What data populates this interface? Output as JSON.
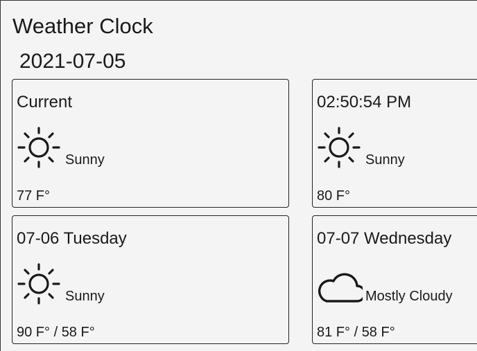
{
  "app": {
    "title": "Weather Clock",
    "date": "2021-07-05"
  },
  "cards": [
    {
      "title": "Current",
      "icon": "sun-icon",
      "condition": "Sunny",
      "temperature": "77 F°"
    },
    {
      "title": "02:50:54 PM",
      "icon": "sun-icon",
      "condition": "Sunny",
      "temperature": "80 F°"
    },
    {
      "title": "07-06 Tuesday",
      "icon": "sun-icon",
      "condition": "Sunny",
      "temperature": "90 F° / 58 F°"
    },
    {
      "title": "07-07 Wednesday",
      "icon": "cloud-icon",
      "condition": "Mostly Cloudy",
      "temperature": "81 F° / 58 F°"
    }
  ]
}
